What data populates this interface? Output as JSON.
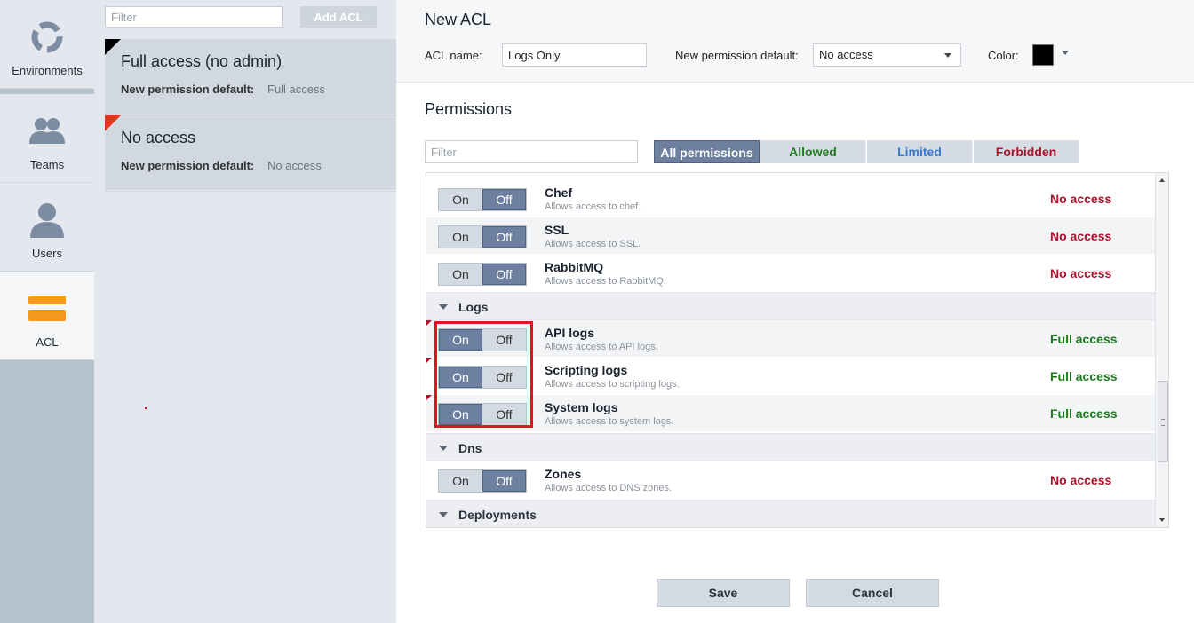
{
  "nav": {
    "items": [
      {
        "label": "Environments",
        "icon": "environments-icon"
      },
      {
        "label": "Teams",
        "icon": "teams-icon"
      },
      {
        "label": "Users",
        "icon": "users-icon"
      },
      {
        "label": "ACL",
        "icon": "acl-icon"
      }
    ],
    "active": "ACL"
  },
  "list": {
    "filter_placeholder": "Filter",
    "add_button": "Add ACL",
    "cards": [
      {
        "title": "Full access (no admin)",
        "key": "New permission default:",
        "value": "Full access",
        "corner_color": "#000000"
      },
      {
        "title": "No access",
        "key": "New permission default:",
        "value": "No access",
        "corner_color": "#e8341c"
      }
    ]
  },
  "editor": {
    "title": "New ACL",
    "acl_name_label": "ACL name:",
    "acl_name_value": "Logs Only",
    "default_label": "New permission default:",
    "default_value": "No access",
    "color_label": "Color:",
    "color_value": "#000000"
  },
  "permissions": {
    "title": "Permissions",
    "filter_placeholder": "Filter",
    "tabs": [
      {
        "label": "All permissions",
        "color": "#ffffff"
      },
      {
        "label": "Allowed",
        "color": "#1e7a1e"
      },
      {
        "label": "Limited",
        "color": "#3a78c8"
      },
      {
        "label": "Forbidden",
        "color": "#b0102a"
      }
    ],
    "on_label": "On",
    "off_label": "Off",
    "rows": [
      {
        "name": "Chef",
        "desc": "Allows access to chef.",
        "status": "No access",
        "state": "off"
      },
      {
        "name": "SSL",
        "desc": "Allows access to SSL.",
        "status": "No access",
        "state": "off"
      },
      {
        "name": "RabbitMQ",
        "desc": "Allows access to RabbitMQ.",
        "status": "No access",
        "state": "off"
      }
    ],
    "groups": [
      {
        "label": "Logs",
        "rows": [
          {
            "name": "API logs",
            "desc": "Allows access to API logs.",
            "status": "Full access",
            "state": "on"
          },
          {
            "name": "Scripting logs",
            "desc": "Allows access to scripting logs.",
            "status": "Full access",
            "state": "on"
          },
          {
            "name": "System logs",
            "desc": "Allows access to system logs.",
            "status": "Full access",
            "state": "on"
          }
        ]
      },
      {
        "label": "Dns",
        "rows": [
          {
            "name": "Zones",
            "desc": "Allows access to DNS zones.",
            "status": "No access",
            "state": "off"
          }
        ]
      },
      {
        "label": "Deployments",
        "rows": []
      }
    ]
  },
  "footer": {
    "save": "Save",
    "cancel": "Cancel"
  }
}
